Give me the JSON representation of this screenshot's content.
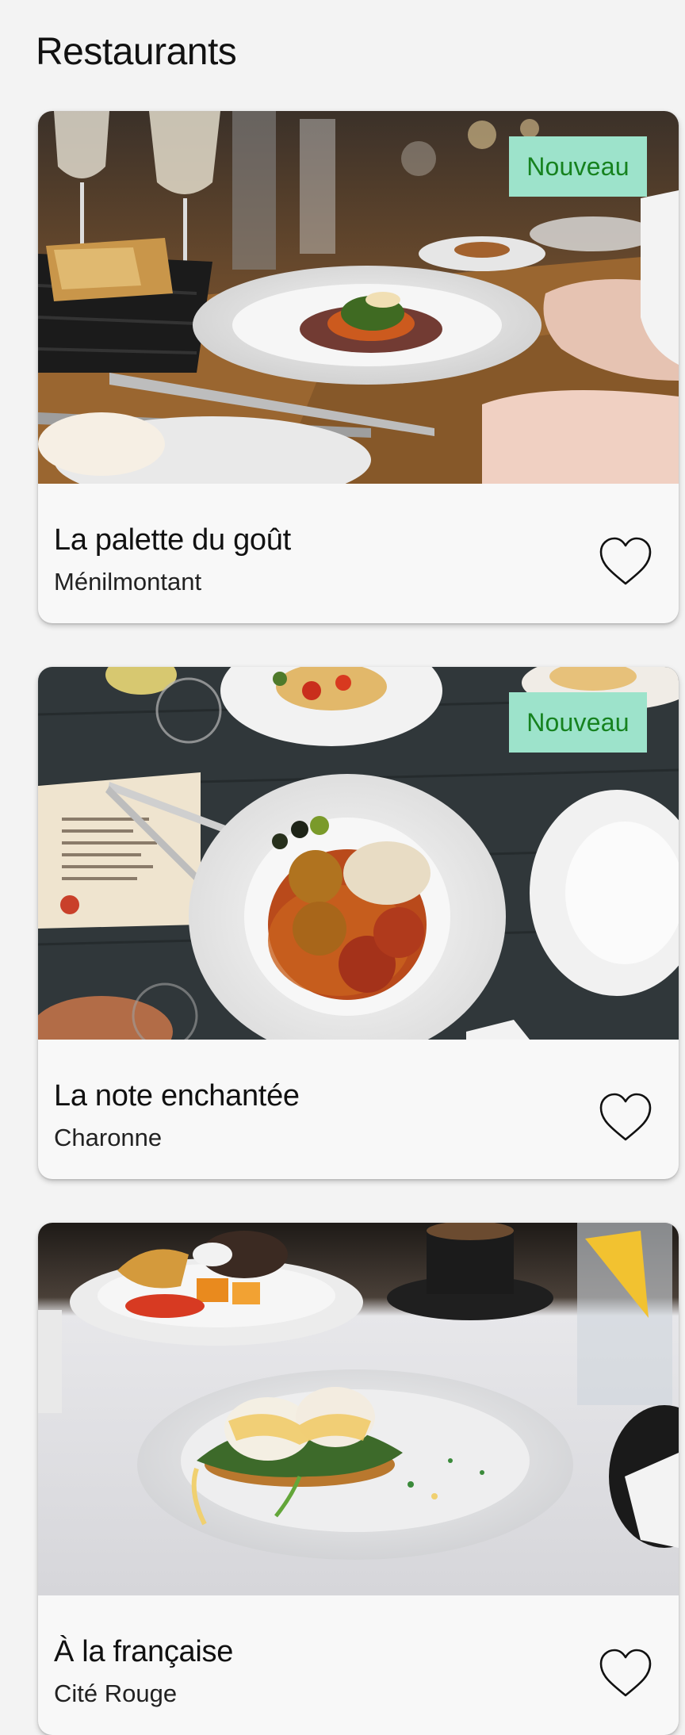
{
  "page": {
    "title": "Restaurants"
  },
  "restaurants": [
    {
      "name": "La palette du goût",
      "district": "Ménilmontant",
      "badge": "Nouveau",
      "favorite": false,
      "photo": "plated-dish-dinner-table"
    },
    {
      "name": "La note enchantée",
      "district": "Charonne",
      "badge": "Nouveau",
      "favorite": false,
      "photo": "meatballs-plate-with-menu"
    },
    {
      "name": "À la française",
      "district": "Cité Rouge",
      "badge": "",
      "favorite": false,
      "photo": "eggs-benedict-brunch-table"
    }
  ],
  "colors": {
    "background": "#f3f3f3",
    "card": "#f8f8f8",
    "badge_bg": "#9de3cb",
    "badge_text": "#16821f"
  },
  "icons": {
    "favorite": "heart-outline-icon"
  }
}
